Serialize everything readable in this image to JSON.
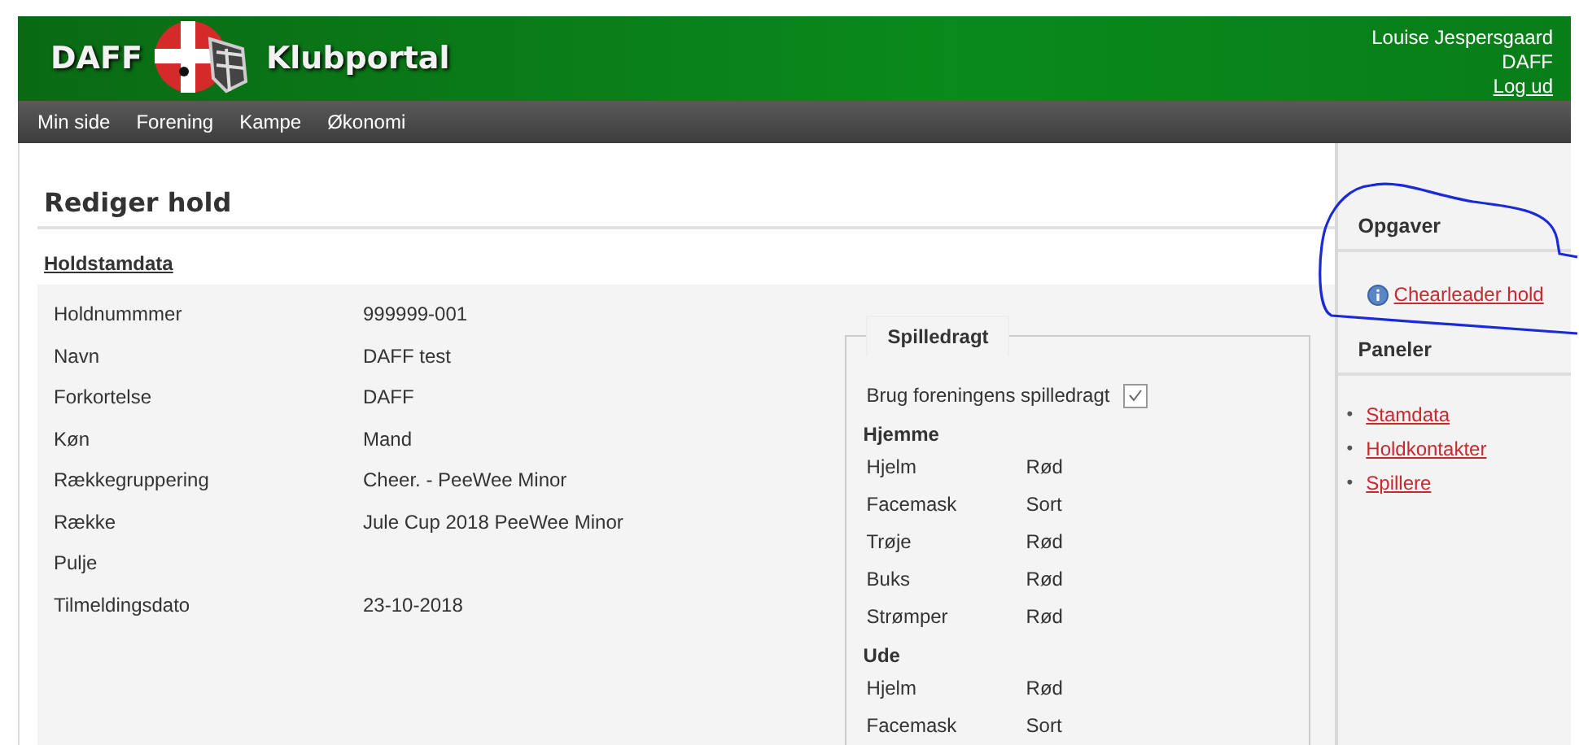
{
  "header": {
    "brand_left": "DAFF",
    "brand_right": "Klubportal",
    "user_name": "Louise Jespersgaard",
    "user_org": "DAFF",
    "logout": "Log ud"
  },
  "nav": [
    {
      "label": "Min side"
    },
    {
      "label": "Forening"
    },
    {
      "label": "Kampe"
    },
    {
      "label": "Økonomi"
    }
  ],
  "main": {
    "title": "Rediger hold",
    "section": "Holdstamdata",
    "fields": [
      {
        "label": "Holdnummmer",
        "value": "999999-001"
      },
      {
        "label": "Navn",
        "value": "DAFF test"
      },
      {
        "label": "Forkortelse",
        "value": "DAFF"
      },
      {
        "label": "Køn",
        "value": "Mand"
      },
      {
        "label": "Rækkegruppering",
        "value": "Cheer. - PeeWee Minor"
      },
      {
        "label": "Række",
        "value": "Jule Cup 2018 PeeWee Minor"
      },
      {
        "label": "Pulje"
      },
      {
        "label": "Tilmeldingsdato",
        "value": "23-10-2018"
      }
    ],
    "kit": {
      "legend": "Spilledragt",
      "checkbox": {
        "label": "Brug foreningens spilledragt",
        "checked": true
      },
      "groups": [
        {
          "title": "Hjemme",
          "items": [
            {
              "part": "Hjelm",
              "value": "Rød"
            },
            {
              "part": "Facemask",
              "value": "Sort"
            },
            {
              "part": "Trøje",
              "value": "Rød"
            },
            {
              "part": "Buks",
              "value": "Rød"
            },
            {
              "part": "Strømper",
              "value": "Rød"
            }
          ]
        },
        {
          "title": "Ude",
          "items": [
            {
              "part": "Hjelm",
              "value": "Rød"
            },
            {
              "part": "Facemask",
              "value": "Sort"
            }
          ]
        }
      ]
    }
  },
  "sidebar": {
    "tasks_title": "Opgaver",
    "tasks": [
      {
        "label": "Chearleader hold"
      }
    ],
    "panels_title": "Paneler",
    "panels": [
      {
        "bullet": "•",
        "label": "Stamdata"
      },
      {
        "bullet": "•",
        "label": "Holdkontakter"
      },
      {
        "bullet": "•",
        "label": "Spillere"
      }
    ]
  }
}
